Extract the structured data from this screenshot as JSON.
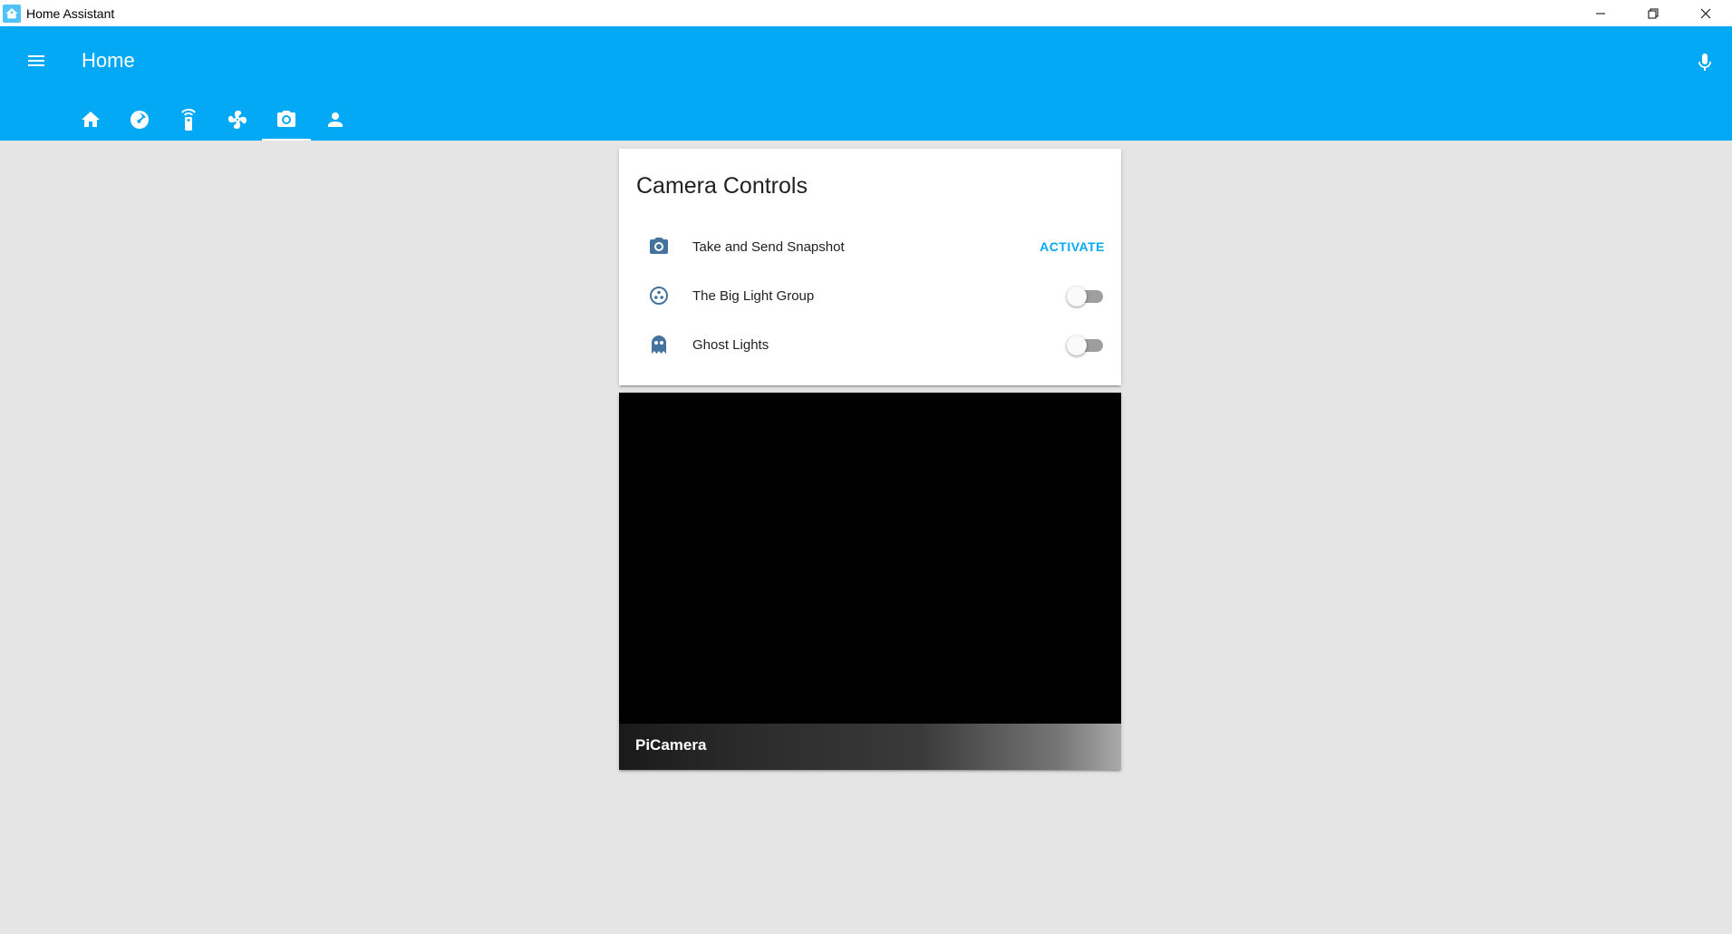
{
  "window": {
    "title": "Home Assistant"
  },
  "header": {
    "title": "Home"
  },
  "tabs": [
    {
      "icon": "home-icon"
    },
    {
      "icon": "gauge-icon"
    },
    {
      "icon": "remote-icon"
    },
    {
      "icon": "fan-icon"
    },
    {
      "icon": "camera-icon",
      "active": true
    },
    {
      "icon": "account-icon"
    }
  ],
  "controls_card": {
    "title": "Camera Controls",
    "rows": [
      {
        "icon": "camera-icon",
        "label": "Take and Send Snapshot",
        "action": "ACTIVATE"
      },
      {
        "icon": "group-icon",
        "label": "The Big Light Group",
        "state": "off"
      },
      {
        "icon": "ghost-icon",
        "label": "Ghost Lights",
        "state": "off"
      }
    ]
  },
  "camera_card": {
    "name": "PiCamera"
  },
  "colors": {
    "primary": "#03a9f4",
    "icon": "#44739e",
    "background": "#e5e5e5"
  }
}
